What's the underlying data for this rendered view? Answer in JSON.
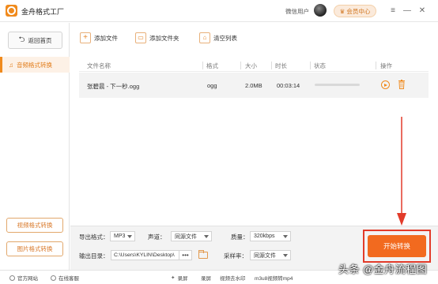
{
  "app": {
    "title": "金舟格式工厂",
    "user_name": "微信用户",
    "vip_label": "会员中心"
  },
  "window_controls": {
    "menu": "≡",
    "minimize": "—",
    "close": "✕"
  },
  "sidebar": {
    "home_label": "返回首页",
    "active_item": "音频格式转换",
    "video_convert": "视频格式转换",
    "image_convert": "图片格式转换"
  },
  "toolbar": {
    "add_file": "添加文件",
    "add_folder": "添加文件夹",
    "clear_list": "清空列表"
  },
  "table": {
    "headers": {
      "name": "文件名称",
      "format": "格式",
      "size": "大小",
      "duration": "时长",
      "status": "状态",
      "action": "操作"
    },
    "rows": [
      {
        "name": "张碧晨 - 下一秒.ogg",
        "format": "ogg",
        "size": "2.0MB",
        "duration": "00:03:14",
        "progress": 0
      }
    ]
  },
  "settings": {
    "output_format_label": "导出格式：",
    "output_format_value": "MP3",
    "channel_label": "声道：",
    "channel_value": "同源文件",
    "quality_label": "质量：",
    "quality_value": "320kbps",
    "output_dir_label": "输出目录：",
    "output_dir_value": "C:\\Users\\KYLIN\\Desktop\\",
    "more_label": "•••",
    "sample_rate_label": "采样率：",
    "sample_rate_value": "同源文件"
  },
  "start_button": "开始转换",
  "statusbar": {
    "website": "官方网站",
    "service": "在线客服",
    "record": "录屏",
    "record2": "录屏",
    "watermark_remove": "视频去水印",
    "m3u8": "m3u8视频转mp4"
  },
  "watermark_text": "头条 @金舟流程图",
  "colors": {
    "accent": "#f08a1c",
    "start": "#f26a1f",
    "highlight_border": "#e23b2a"
  }
}
